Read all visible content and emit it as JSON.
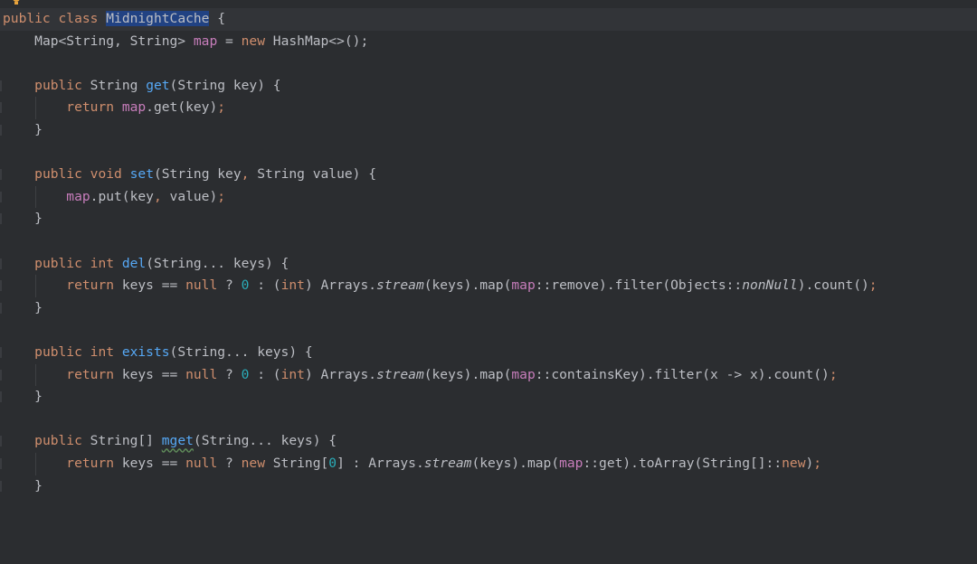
{
  "editor": {
    "line1": {
      "kw1": "public",
      "kw2": "class",
      "name": "MidnightCache",
      "brace": "{"
    },
    "line2": {
      "type": "Map<String, String>",
      "field": "map",
      "eq": "=",
      "new": "new",
      "ctor": "HashMap<>();"
    },
    "get": {
      "kw1": "public",
      "type": "String",
      "name": "get",
      "params": "(String key) {",
      "ret": "return",
      "field": "map",
      "body": ".get(key)",
      "semi": ";"
    },
    "set": {
      "kw1": "public",
      "kw2": "void",
      "name": "set",
      "params1": "(String key",
      "comma": ",",
      "params2": " String value) {",
      "field": "map",
      "body1": ".put(key",
      "comma2": ",",
      "body2": " value)",
      "semi": ";"
    },
    "del": {
      "kw1": "public",
      "kw2": "int",
      "name": "del",
      "params": "(String... keys) {",
      "ret": "return",
      "p1": "keys == ",
      "null": "null",
      "q": " ? ",
      "zero": "0",
      "colon": " : (",
      "int": "int",
      "p2": ") Arrays.",
      "stream": "stream",
      "p3": "(keys).map(",
      "field": "map",
      "p4": "::remove).filter(Objects::",
      "nonNull": "nonNull",
      "p5": ").count()",
      "semi": ";"
    },
    "exists": {
      "kw1": "public",
      "kw2": "int",
      "name": "exists",
      "params": "(String... keys) {",
      "ret": "return",
      "p1": "keys == ",
      "null": "null",
      "q": " ? ",
      "zero": "0",
      "colon": " : (",
      "int": "int",
      "p2": ") Arrays.",
      "stream": "stream",
      "p3": "(keys).map(",
      "field": "map",
      "p4": "::containsKey).filter(x -> x).count()",
      "semi": ";"
    },
    "mget": {
      "kw1": "public",
      "type": "String[]",
      "name": "mget",
      "params": "(String... keys) {",
      "ret": "return",
      "p1": "keys == ",
      "null": "null",
      "q": " ? ",
      "new": "new",
      "p2": " String[",
      "zero": "0",
      "p3": "] : Arrays.",
      "stream": "stream",
      "p4": "(keys).map(",
      "field": "map",
      "p5": "::get).toArray(String[]::",
      "new2": "new",
      "p6": ")",
      "semi": ";"
    },
    "close": "}"
  },
  "colors": {
    "background": "#2b2d30",
    "keyword": "#cf8e6d",
    "function": "#56a8f5",
    "field": "#c77dbb",
    "number": "#2aacb8",
    "text": "#bcbec4",
    "selection": "#214283"
  },
  "icons": {
    "intention": "lightbulb-icon"
  }
}
